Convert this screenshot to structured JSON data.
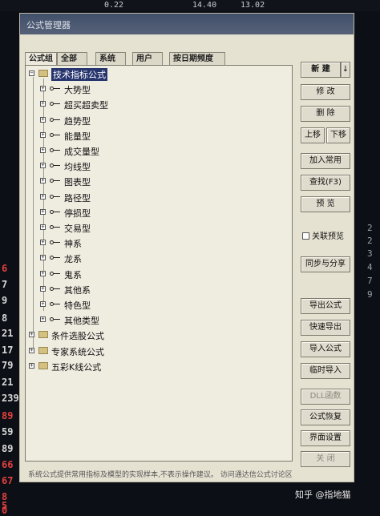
{
  "background": {
    "top_values": [
      "0.22",
      "14.40",
      "13.02"
    ],
    "left_numbers": [
      {
        "text": "6",
        "color": "#e04040"
      },
      {
        "text": "7",
        "color": "#d8d8d8"
      },
      {
        "text": "9",
        "color": "#d8d8d8"
      },
      {
        "text": "8",
        "color": "#d8d8d8"
      },
      {
        "text": "21",
        "color": "#d8d8d8"
      },
      {
        "text": "17",
        "color": "#d8d8d8"
      },
      {
        "text": "79",
        "color": "#d8d8d8"
      },
      {
        "text": "21",
        "color": "#d8d8d8"
      },
      {
        "text": "239",
        "color": "#d8d8d8"
      },
      {
        "text": "89",
        "color": "#e04040"
      },
      {
        "text": "59",
        "color": "#d8d8d8"
      },
      {
        "text": "89",
        "color": "#d8d8d8"
      },
      {
        "text": "66",
        "color": "#e04040"
      },
      {
        "text": "67",
        "color": "#e04040"
      },
      {
        "text": "8",
        "color": "#e04040"
      },
      {
        "text": "5",
        "color": "#e04040"
      },
      {
        "text": "0",
        "color": "#e04040"
      }
    ],
    "right_numbers": [
      "2",
      "2",
      "3",
      "4",
      "7",
      "9"
    ]
  },
  "window": {
    "title": "公式管理器"
  },
  "tabs": [
    {
      "label": "公式组"
    },
    {
      "label": "全部"
    },
    {
      "label": "系统"
    },
    {
      "label": "用户"
    },
    {
      "label": "按日期频度"
    }
  ],
  "tree": {
    "root": "技术指标公式",
    "children": [
      "大势型",
      "超买超卖型",
      "趋势型",
      "能量型",
      "成交量型",
      "均线型",
      "图表型",
      "路径型",
      "停损型",
      "交易型",
      "神系",
      "龙系",
      "鬼系",
      "其他系",
      "特色型",
      "其他类型"
    ],
    "other_roots": [
      "条件选股公式",
      "专家系统公式",
      "五彩K线公式"
    ]
  },
  "buttons": {
    "new": "新 建",
    "new_arrow": "↓",
    "edit": "修 改",
    "delete": "删 除",
    "move_up": "上移",
    "move_down": "下移",
    "add_favorite": "加入常用",
    "find": "查找(F3)",
    "preview": "预 览",
    "linked_preview": "关联预览",
    "sync_share": "同步与分享",
    "export": "导出公式",
    "quick_export": "快速导出",
    "import": "导入公式",
    "temp_import": "临时导入",
    "dll": "DLL函数",
    "restore": "公式恢复",
    "ui_settings": "界面设置",
    "close": "关 闭"
  },
  "status_text": "系统公式提供常用指标及模型的实现样本,不表示操作建议。 访问通达信公式讨论区",
  "watermark": "知乎 @指地猫"
}
